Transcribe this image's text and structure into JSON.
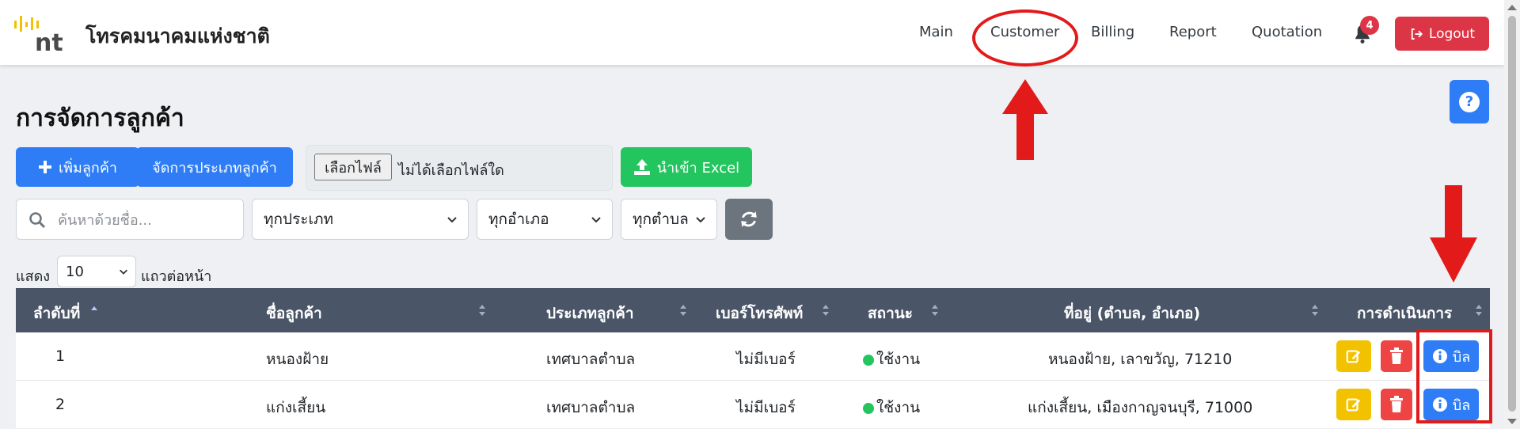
{
  "header": {
    "brand_mark": "nt",
    "brand_name": "โทรคมนาคมแห่งชาติ",
    "nav": [
      "Main",
      "Customer",
      "Billing",
      "Report",
      "Quotation"
    ],
    "notification_count": "4",
    "logout_label": "Logout"
  },
  "page": {
    "title": "การจัดการลูกค้า",
    "add_customer_label": "เพิ่มลูกค้า",
    "manage_types_label": "จัดการประเภทลูกค้า",
    "choose_file_label": "เลือกไฟล์",
    "no_file_label": "ไม่ได้เลือกไฟล์ใด",
    "import_excel_label": "นำเข้า Excel",
    "help_icon_text": "?"
  },
  "filters": {
    "search_placeholder": "ค้นหาด้วยชื่อ...",
    "type_select": "ทุกประเภท",
    "district_select": "ทุกอำเภอ",
    "subdistrict_select": "ทุกตำบล"
  },
  "pagination": {
    "show_label": "แสดง",
    "per_page": "10",
    "rows_per_page_label": "แถวต่อหน้า"
  },
  "table": {
    "headers": [
      "ลำดับที่",
      "ชื่อลูกค้า",
      "ประเภทลูกค้า",
      "เบอร์โทรศัพท์",
      "สถานะ",
      "ที่อยู่ (ตำบล, อำเภอ)",
      "การดำเนินการ"
    ],
    "rows": [
      {
        "no": "1",
        "name": "หนองฝ้าย",
        "type": "เทศบาลตำบล",
        "phone": "ไม่มีเบอร์",
        "status": "ใช้งาน",
        "address": "หนองฝ้าย, เลาขวัญ, 71210",
        "bill_label": "บิล"
      },
      {
        "no": "2",
        "name": "แก่งเสี้ยน",
        "type": "เทศบาลตำบล",
        "phone": "ไม่มีเบอร์",
        "status": "ใช้งาน",
        "address": "แก่งเสี้ยน, เมืองกาญจนบุรี, 71000",
        "bill_label": "บิล"
      }
    ]
  },
  "colors": {
    "primary": "#2f7df6",
    "success": "#22c55e",
    "danger": "#dc3545",
    "warning": "#f2c200",
    "table_header": "#4a5568",
    "annotation": "#e31a1a"
  }
}
